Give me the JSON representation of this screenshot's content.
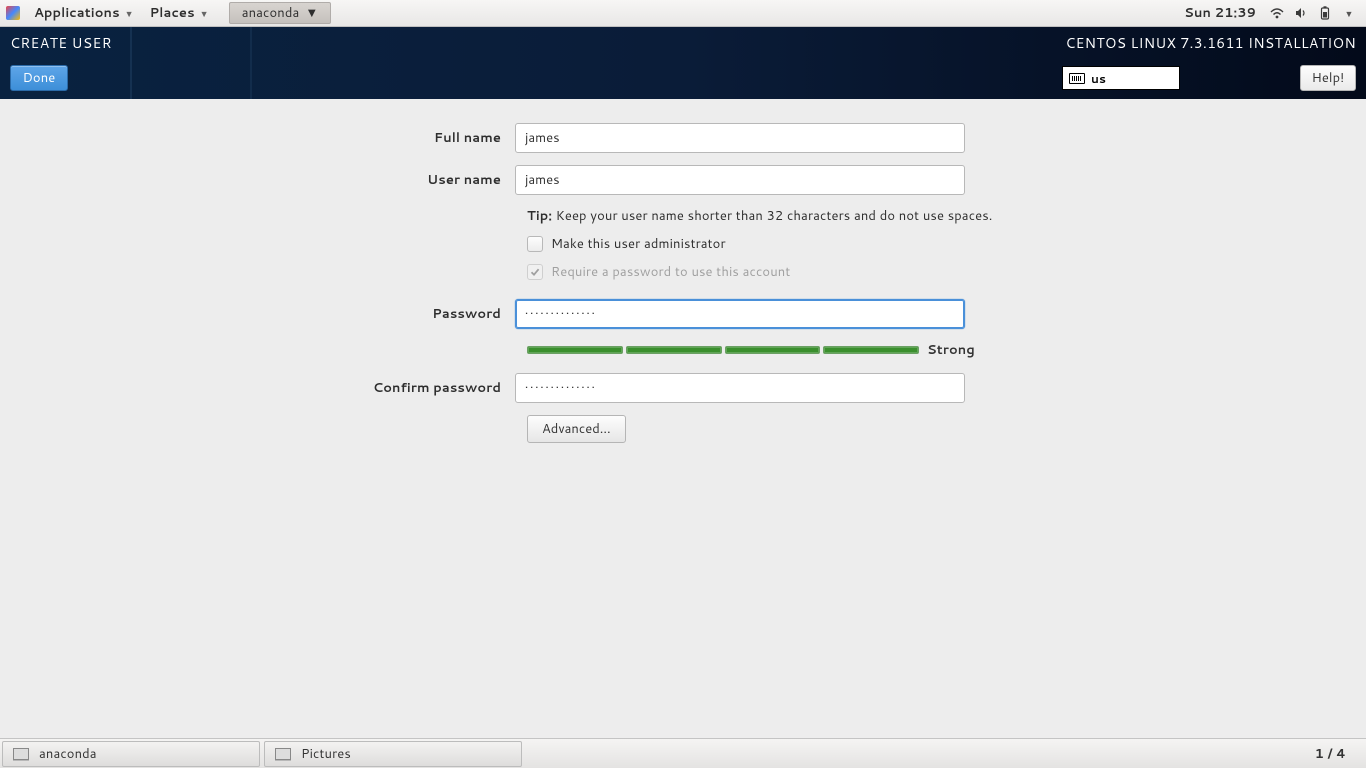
{
  "gnome": {
    "apps": "Applications",
    "places": "Places",
    "task": "anaconda",
    "clock": "Sun 21:39"
  },
  "header": {
    "title": "CREATE USER",
    "done": "Done",
    "install_name": "CENTOS LINUX 7.3.1611 INSTALLATION",
    "keyboard": "us",
    "help": "Help!"
  },
  "form": {
    "full_name_label": "Full name",
    "full_name_value": "james",
    "user_name_label": "User name",
    "user_name_value": "james",
    "tip_prefix": "Tip:",
    "tip_text": " Keep your user name shorter than 32 characters and do not use spaces.",
    "make_admin": "Make this user administrator",
    "require_password": "Require a password to use this account",
    "password_label": "Password",
    "password_value": "••••••••••••••",
    "confirm_label": "Confirm password",
    "confirm_value": "••••••••••••••",
    "strength_label": "Strong",
    "advanced": "Advanced..."
  },
  "taskbar": {
    "task1": "anaconda",
    "task2": "Pictures",
    "workspace": "1 / 4"
  }
}
